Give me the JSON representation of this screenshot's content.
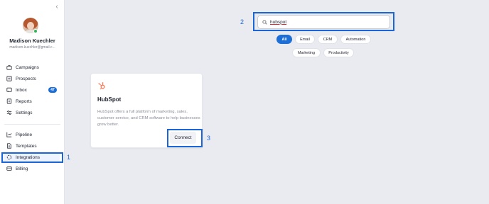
{
  "sidebar": {
    "collapse_glyph": "‹",
    "user": {
      "name": "Madison Kuechler",
      "email": "madison.kuechler@gmail.c..."
    },
    "nav_primary": [
      {
        "label": "Campaigns",
        "icon": "briefcase-icon"
      },
      {
        "label": "Prospects",
        "icon": "list-icon"
      },
      {
        "label": "Inbox",
        "icon": "inbox-icon",
        "badge": "47"
      },
      {
        "label": "Reports",
        "icon": "reports-icon"
      },
      {
        "label": "Settings",
        "icon": "sliders-icon"
      }
    ],
    "nav_secondary": [
      {
        "label": "Pipeline",
        "icon": "chart-line-icon"
      },
      {
        "label": "Templates",
        "icon": "document-icon"
      },
      {
        "label": "Integrations",
        "icon": "puzzle-icon",
        "active": true
      },
      {
        "label": "Billing",
        "icon": "credit-card-icon"
      }
    ]
  },
  "search": {
    "value": "hubspot",
    "icon": "search-icon"
  },
  "filters": {
    "row1": [
      "All",
      "Email",
      "CRM",
      "Automation"
    ],
    "row2": [
      "Marketing",
      "Productivity"
    ],
    "selected": "All"
  },
  "card": {
    "logo": "hubspot-logo",
    "title": "HubSpot",
    "description": "HubSpot offers a full platform of marketing, sales, customer service, and CRM software to help businesses grow better.",
    "connect_label": "Connect"
  },
  "annotations": {
    "step1": "1",
    "step2": "2",
    "step3": "3"
  },
  "colors": {
    "accent": "#1d6fd8",
    "highlight": "#1b66d6",
    "hubspot": "#ff7a59",
    "background": "#e9ebf0"
  }
}
